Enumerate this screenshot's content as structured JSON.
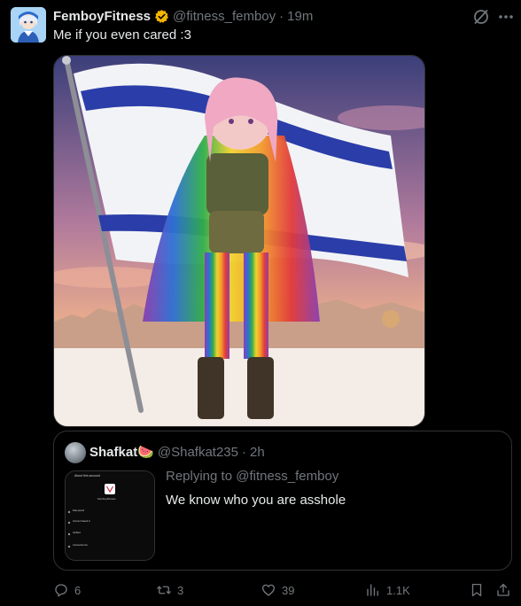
{
  "tweet": {
    "author": {
      "display_name": "FemboyFitness",
      "handle": "@fitness_femboy",
      "verified": true,
      "avatar_icon": "anime-avatar"
    },
    "separator": "·",
    "time": "19m",
    "text": "Me if you even cared :3",
    "media": {
      "description_icon": "illustration-image"
    }
  },
  "quote": {
    "author": {
      "display_name": "Shafkat🍉",
      "handle": "@Shafkat235"
    },
    "separator": "·",
    "time": "2h",
    "replying_to": "Replying to @fitness_femboy",
    "text": "We know who you are asshole",
    "thumbnail": {
      "title": "About this account",
      "name": "FemboyFitness",
      "items": [
        "Date joined",
        "Account based in",
        "Verified",
        "Connected via"
      ]
    }
  },
  "actions": {
    "reply_count": "6",
    "retweet_count": "3",
    "like_count": "39",
    "view_count": "1.1K"
  },
  "colors": {
    "background": "#000000",
    "text": "#e7e9ea",
    "secondary": "#71767b",
    "border": "#2f3336",
    "verified": "#f4b400"
  }
}
